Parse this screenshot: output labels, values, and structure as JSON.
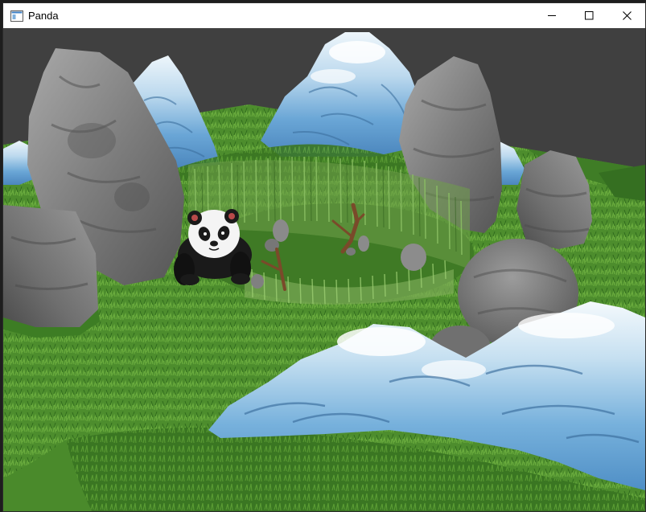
{
  "window": {
    "title": "Panda",
    "icon": "app-window-icon"
  },
  "controls": {
    "minimize_icon": "minimize-icon",
    "maximize_icon": "maximize-icon",
    "close_icon": "close-icon"
  },
  "scene": {
    "colors": {
      "sky": "#414141",
      "grass_light": "#4e8f2e",
      "grass_dark": "#2f6a1c",
      "rock": "#808080",
      "mountain_blue": "#6fa9d8",
      "snow": "#f2f7fb",
      "bamboo": "#7fb35a"
    }
  }
}
